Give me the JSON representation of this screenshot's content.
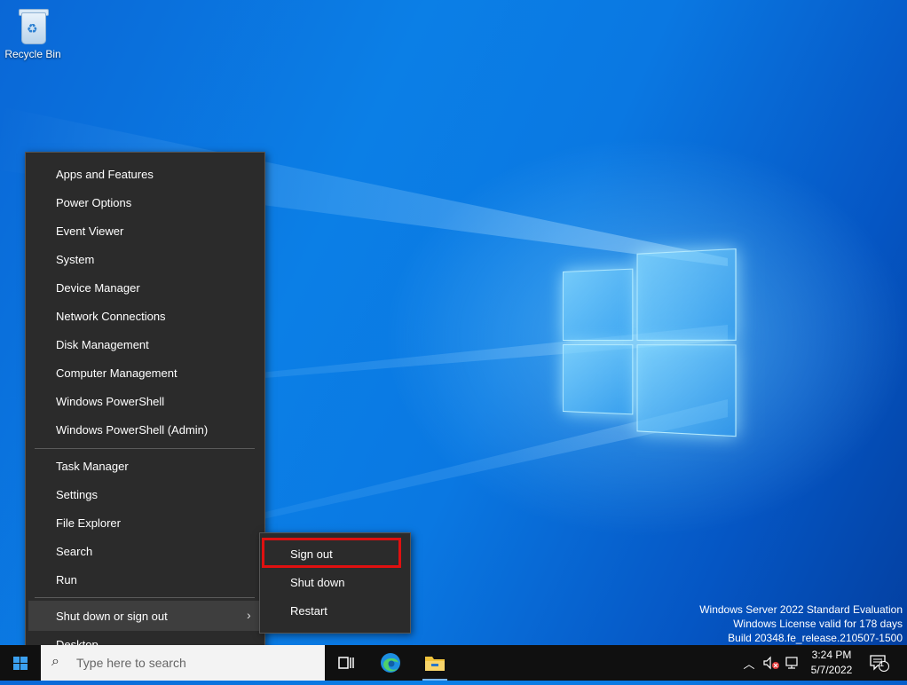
{
  "desktop": {
    "icons": [
      {
        "label": "Recycle Bin",
        "icon": "recycle-bin-icon"
      }
    ],
    "watermark": {
      "line1": "Windows Server 2022 Standard Evaluation",
      "line2": "Windows License valid for 178 days",
      "line3": "Build 20348.fe_release.210507-1500"
    }
  },
  "context_menu": {
    "group1": [
      "Apps and Features",
      "Power Options",
      "Event Viewer",
      "System",
      "Device Manager",
      "Network Connections",
      "Disk Management",
      "Computer Management",
      "Windows PowerShell",
      "Windows PowerShell (Admin)"
    ],
    "group2": [
      "Task Manager",
      "Settings",
      "File Explorer",
      "Search",
      "Run"
    ],
    "group3": [
      "Shut down or sign out",
      "Desktop"
    ],
    "highlighted": "Shut down or sign out"
  },
  "submenu": {
    "items": [
      "Sign out",
      "Shut down",
      "Restart"
    ],
    "emphasized": "Sign out",
    "emphasis_color": "#e01010"
  },
  "taskbar": {
    "search_placeholder": "Type here to search",
    "pinned": [
      "task-view-icon",
      "edge-icon",
      "file-explorer-icon"
    ],
    "clock": {
      "time": "3:24 PM",
      "date": "5/7/2022"
    },
    "notification_count": "1"
  },
  "colors": {
    "menu_bg": "#2b2b2b",
    "taskbar_bg": "#101010",
    "accent": "#0a78e2"
  }
}
